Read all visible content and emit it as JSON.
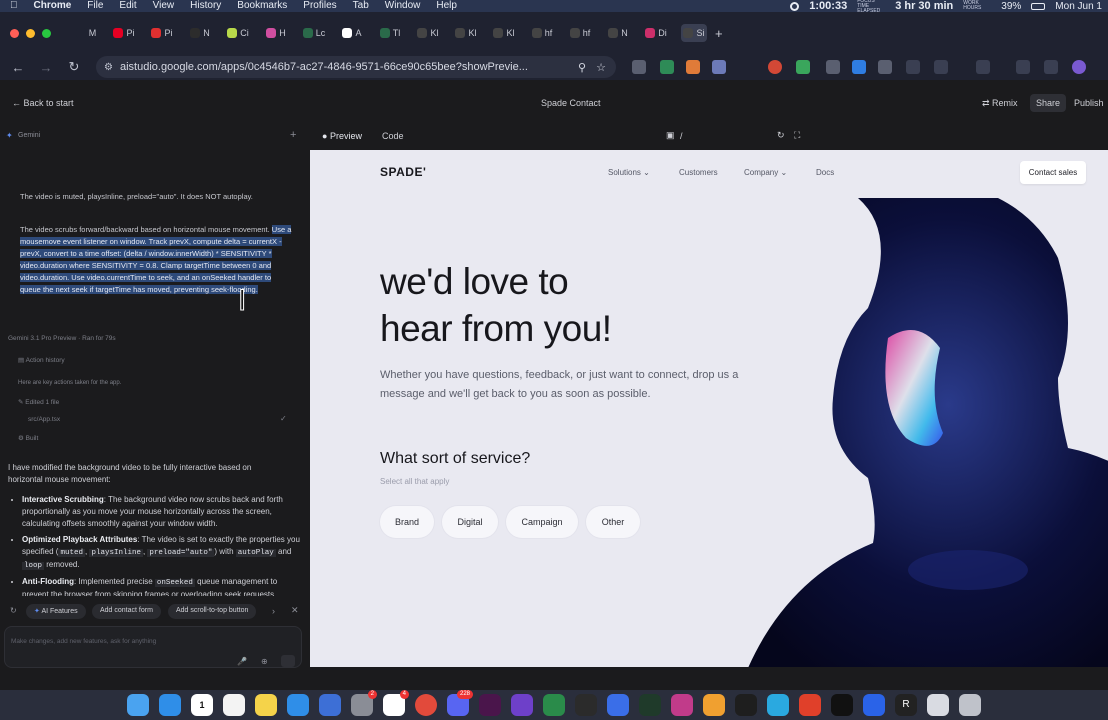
{
  "menubar": {
    "app": "Chrome",
    "items": [
      "File",
      "Edit",
      "View",
      "History",
      "Bookmarks",
      "Profiles",
      "Tab",
      "Window",
      "Help"
    ],
    "timer": "1:00:33",
    "timer_caption": "FOCUS TIME ELAPSED",
    "hours": "3 hr 30 min",
    "hours_caption": "WORK HOURS",
    "battery": "39%",
    "date": "Mon Jun 1"
  },
  "browser": {
    "url": "aistudio.google.com/apps/0c4546b7-ac27-4846-9571-66ce90c65bee?showPrevie..."
  },
  "tabs": [
    {
      "label": "M",
      "color": "#1f2230",
      "icon": "b"
    },
    {
      "label": "Pi",
      "color": "#e60023"
    },
    {
      "label": "Pi",
      "color": "#e03030"
    },
    {
      "label": "N",
      "color": "#2c2c2c"
    },
    {
      "label": "Ci",
      "color": "#b8d94a"
    },
    {
      "label": "H",
      "color": "#d04ea0"
    },
    {
      "label": "Lc",
      "color": "#2a6a4a"
    },
    {
      "label": "A",
      "color": "#ffffff"
    },
    {
      "label": "Tl",
      "color": "#2a6a4a"
    },
    {
      "label": "Kl",
      "color": "#444"
    },
    {
      "label": "Kl",
      "color": "#444"
    },
    {
      "label": "Kl",
      "color": "#444"
    },
    {
      "label": "hf",
      "color": "#444"
    },
    {
      "label": "hf",
      "color": "#444"
    },
    {
      "label": "N",
      "color": "#444"
    },
    {
      "label": "Di",
      "color": "#cc2f6a"
    },
    {
      "label": "Si",
      "color": "#444"
    }
  ],
  "app": {
    "back_label": "Back to start",
    "project_title": "Spade Contact",
    "remix": "Remix",
    "share": "Share",
    "publish": "Publish",
    "panel_title": "Gemini",
    "preview_tab": "Preview",
    "code_tab": "Code",
    "path": "/"
  },
  "chat": {
    "para1": "The video is muted, playsInline, preload=\"auto\". It does NOT autoplay.",
    "para2_plain": "The video scrubs forward/backward based on horizontal mouse movement. ",
    "para2_selected": "Use a mousemove event listener on window. Track prevX, compute delta = currentX - prevX, convert to a time offset: (delta / window.innerWidth) * SENSITIVITY * video.duration where SENSITIVITY = 0.8. Clamp targetTime between 0 and video.duration. Use video.currentTime to seek, and an onSeeked handler to queue the next seek if targetTime has moved, preventing seek-flooding.",
    "model_line": "Gemini 3.1 Pro Preview",
    "run_time": "Ran for 79s",
    "action_history": "Action history",
    "actions_note": "Here are key actions taken for the app.",
    "edited": "Edited 1 file",
    "file": "src/App.tsx",
    "built": "Built",
    "summary": "I have modified the background video to be fully interactive based on horizontal mouse movement:",
    "b1_title": "Interactive Scrubbing",
    "b1_text": ": The background video now scrubs back and forth proportionally as you move your mouse horizontally across the screen, calculating offsets smoothly against your window width.",
    "b2_title": "Optimized Playback Attributes",
    "b2_text1": ": The video is set to exactly the properties you specified (",
    "b2_code1": "muted",
    "b2_code2": "playsInline",
    "b2_code3": "preload=\"auto\"",
    "b2_text2": ") with ",
    "b2_code4": "autoPlay",
    "b2_text3": " and ",
    "b2_code5": "loop",
    "b2_text4": " removed.",
    "b3_title": "Anti-Flooding",
    "b3_text1": ": Implemented precise ",
    "b3_code1": "onSeeked",
    "b3_text2": " queue management to prevent the browser from skipping frames or overloading seek requests",
    "chip1": "AI Features",
    "chip2": "Add contact form",
    "chip3": "Add scroll-to-top button",
    "input_placeholder": "Make changes, add new features, ask for anything"
  },
  "site": {
    "logo": "SPADE'",
    "nav": [
      "Solutions",
      "Customers",
      "Company",
      "Docs"
    ],
    "cta": "Contact sales",
    "headline_line1": "we'd love to",
    "headline_line2": "hear from you!",
    "intro": "Whether you have questions, feedback, or just want to connect, drop us a message and we'll get back to you as soon as possible.",
    "service_title": "What sort of service?",
    "service_sub": "Select all that apply",
    "services": [
      "Brand",
      "Digital",
      "Campaign",
      "Other"
    ]
  },
  "dock": {
    "calendar_day": "1",
    "badges": [
      "2",
      "4",
      "228"
    ]
  }
}
